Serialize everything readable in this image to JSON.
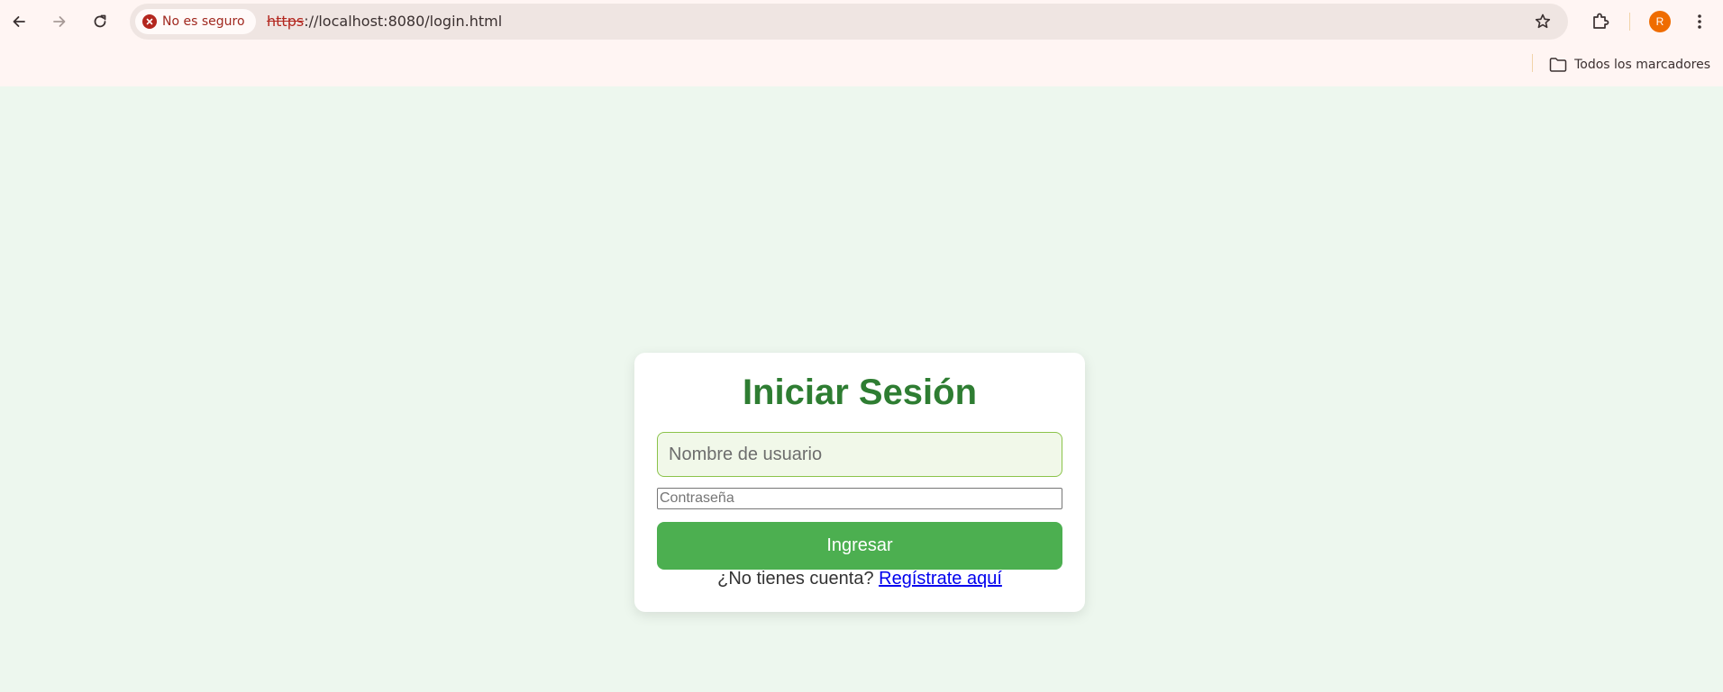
{
  "browser": {
    "security_chip": "No es seguro",
    "url_protocol": "https",
    "url_rest": "://localhost:8080/login.html",
    "profile_initial": "R",
    "bookmarks_label": "Todos los marcadores"
  },
  "login": {
    "title": "Iniciar Sesión",
    "username_placeholder": "Nombre de usuario",
    "password_placeholder": "Contraseña",
    "submit_label": "Ingresar",
    "register_prompt": "¿No tienes cuenta?",
    "register_link": "Regístrate aquí"
  },
  "colors": {
    "page_background": "#edf7ee",
    "title_green": "#2e7d32",
    "button_green": "#4caf50",
    "insecure_red": "#b3261e"
  }
}
